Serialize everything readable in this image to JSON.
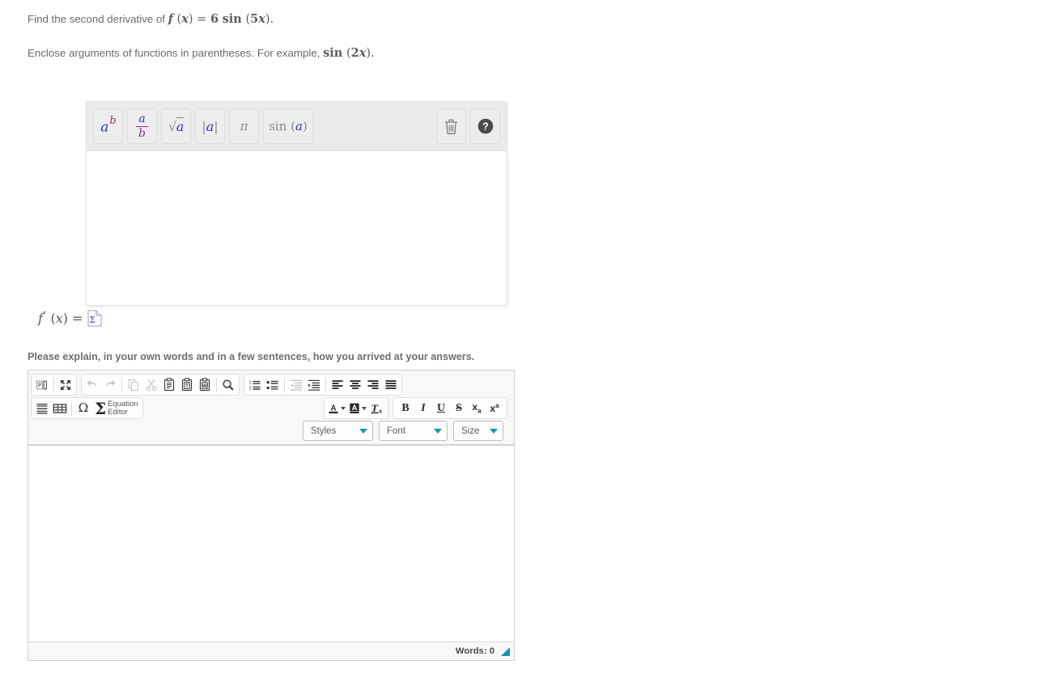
{
  "prompt": {
    "line1_pre": "Find the second derivative of ",
    "line1_math_f": "f",
    "line1_math_rest": "(x) = 6 sin (5x).",
    "line2_pre": "Enclose arguments of functions in parentheses. For example, ",
    "line2_math": "sin (2x)."
  },
  "math_widget": {
    "buttons": [
      {
        "name": "power-button",
        "label": "a^b",
        "title": "Exponent"
      },
      {
        "name": "fraction-button",
        "label": "a/b",
        "title": "Fraction"
      },
      {
        "name": "sqrt-button",
        "label": "sqrt(a)",
        "title": "Square root"
      },
      {
        "name": "abs-button",
        "label": "|a|",
        "title": "Absolute value"
      },
      {
        "name": "pi-button",
        "label": "pi",
        "title": "Pi"
      },
      {
        "name": "sin-button",
        "label": "sin (a)",
        "title": "Sine"
      }
    ],
    "trash_icon": "trash-icon",
    "help_icon": "help-icon",
    "input_value": "",
    "input_placeholder": ""
  },
  "answer": {
    "label_f": "f",
    "label_primes": "″",
    "label_rest": " (x) =",
    "image_icon": "broken-image-icon"
  },
  "explain": {
    "label": "Please explain, in your own words and in a few sentences, how you arrived at your answers."
  },
  "editor": {
    "toolbar_row1_group1": [
      {
        "name": "show-blocks-button",
        "icon": "show-blocks-icon",
        "title": "Show Blocks",
        "disabled": false
      },
      {
        "name": "maximize-button",
        "icon": "maximize-icon",
        "title": "Maximize",
        "disabled": false
      }
    ],
    "toolbar_row1_group2": [
      {
        "name": "undo-button",
        "icon": "undo-icon",
        "title": "Undo",
        "disabled": true
      },
      {
        "name": "redo-button",
        "icon": "redo-icon",
        "title": "Redo",
        "disabled": true
      },
      {
        "name": "copy-button",
        "icon": "copy-icon",
        "title": "Copy",
        "disabled": true
      },
      {
        "name": "cut-button",
        "icon": "cut-icon",
        "title": "Cut",
        "disabled": true
      },
      {
        "name": "paste-button",
        "icon": "paste-icon",
        "title": "Paste",
        "disabled": false
      },
      {
        "name": "paste-as-text-button",
        "icon": "paste-text-icon",
        "title": "Paste as plain text",
        "disabled": false
      },
      {
        "name": "paste-from-word-button",
        "icon": "paste-word-icon",
        "title": "Paste from Word",
        "disabled": false
      },
      {
        "name": "find-button",
        "icon": "search-icon",
        "title": "Find",
        "disabled": false
      }
    ],
    "toolbar_row1_group3": [
      {
        "name": "numbered-list-button",
        "icon": "numbered-list-icon",
        "title": "Insert/Remove Numbered List",
        "disabled": false
      },
      {
        "name": "bulleted-list-button",
        "icon": "bulleted-list-icon",
        "title": "Insert/Remove Bulleted List",
        "disabled": false
      },
      {
        "name": "outdent-button",
        "icon": "outdent-icon",
        "title": "Decrease Indent",
        "disabled": true
      },
      {
        "name": "indent-button",
        "icon": "indent-icon",
        "title": "Increase Indent",
        "disabled": false
      },
      {
        "name": "align-left-button",
        "icon": "align-left-icon",
        "title": "Align Left",
        "disabled": false
      },
      {
        "name": "align-center-button",
        "icon": "align-center-icon",
        "title": "Center",
        "disabled": false
      },
      {
        "name": "align-right-button",
        "icon": "align-right-icon",
        "title": "Align Right",
        "disabled": false
      },
      {
        "name": "justify-button",
        "icon": "justify-icon",
        "title": "Justify",
        "disabled": false
      }
    ],
    "toolbar_row2_group1": [
      {
        "name": "horizontal-rule-button",
        "icon": "horizontal-rule-icon",
        "title": "Insert Horizontal Line",
        "disabled": false
      },
      {
        "name": "table-button",
        "icon": "table-icon",
        "title": "Table",
        "disabled": false
      },
      {
        "name": "special-char-button",
        "icon": "omega-icon",
        "title": "Insert Special Character",
        "disabled": false
      }
    ],
    "equation_editor": {
      "name": "equation-editor-button",
      "label_line1": "Equation",
      "label_line2": "Editor"
    },
    "toolbar_row2_group2": [
      {
        "name": "text-color-button",
        "icon": "text-color-icon",
        "title": "Text Color",
        "disabled": false
      },
      {
        "name": "background-color-button",
        "icon": "bg-color-icon",
        "title": "Background Color",
        "disabled": false
      },
      {
        "name": "remove-format-button",
        "icon": "remove-format-icon",
        "title": "Remove Format",
        "disabled": false
      }
    ],
    "toolbar_row2_group3": [
      {
        "name": "bold-button",
        "icon": "bold-icon",
        "label": "B",
        "title": "Bold"
      },
      {
        "name": "italic-button",
        "icon": "italic-icon",
        "label": "I",
        "title": "Italic"
      },
      {
        "name": "underline-button",
        "icon": "underline-icon",
        "label": "U",
        "title": "Underline"
      },
      {
        "name": "strike-button",
        "icon": "strikethrough-icon",
        "label": "S",
        "title": "Strikethrough"
      },
      {
        "name": "subscript-button",
        "icon": "subscript-icon",
        "label": "x",
        "title": "Subscript"
      },
      {
        "name": "superscript-button",
        "icon": "superscript-icon",
        "label": "x",
        "title": "Superscript"
      }
    ],
    "combos": {
      "styles": "Styles",
      "font": "Font",
      "size": "Size"
    },
    "body_value": "",
    "footer": {
      "word_count": "Words: 0",
      "resize_handle": "resize-handle"
    }
  },
  "colors": {
    "accent_teal": "#1e94ab",
    "math_blue": "#2b35c8",
    "math_purple": "#8e2a8e",
    "math_gray": "#8a8a8a",
    "text_gray": "#6b6b6b",
    "toolbar_bg": "#ebebeb",
    "editor_toolbar_bg": "#f8f8f8"
  }
}
